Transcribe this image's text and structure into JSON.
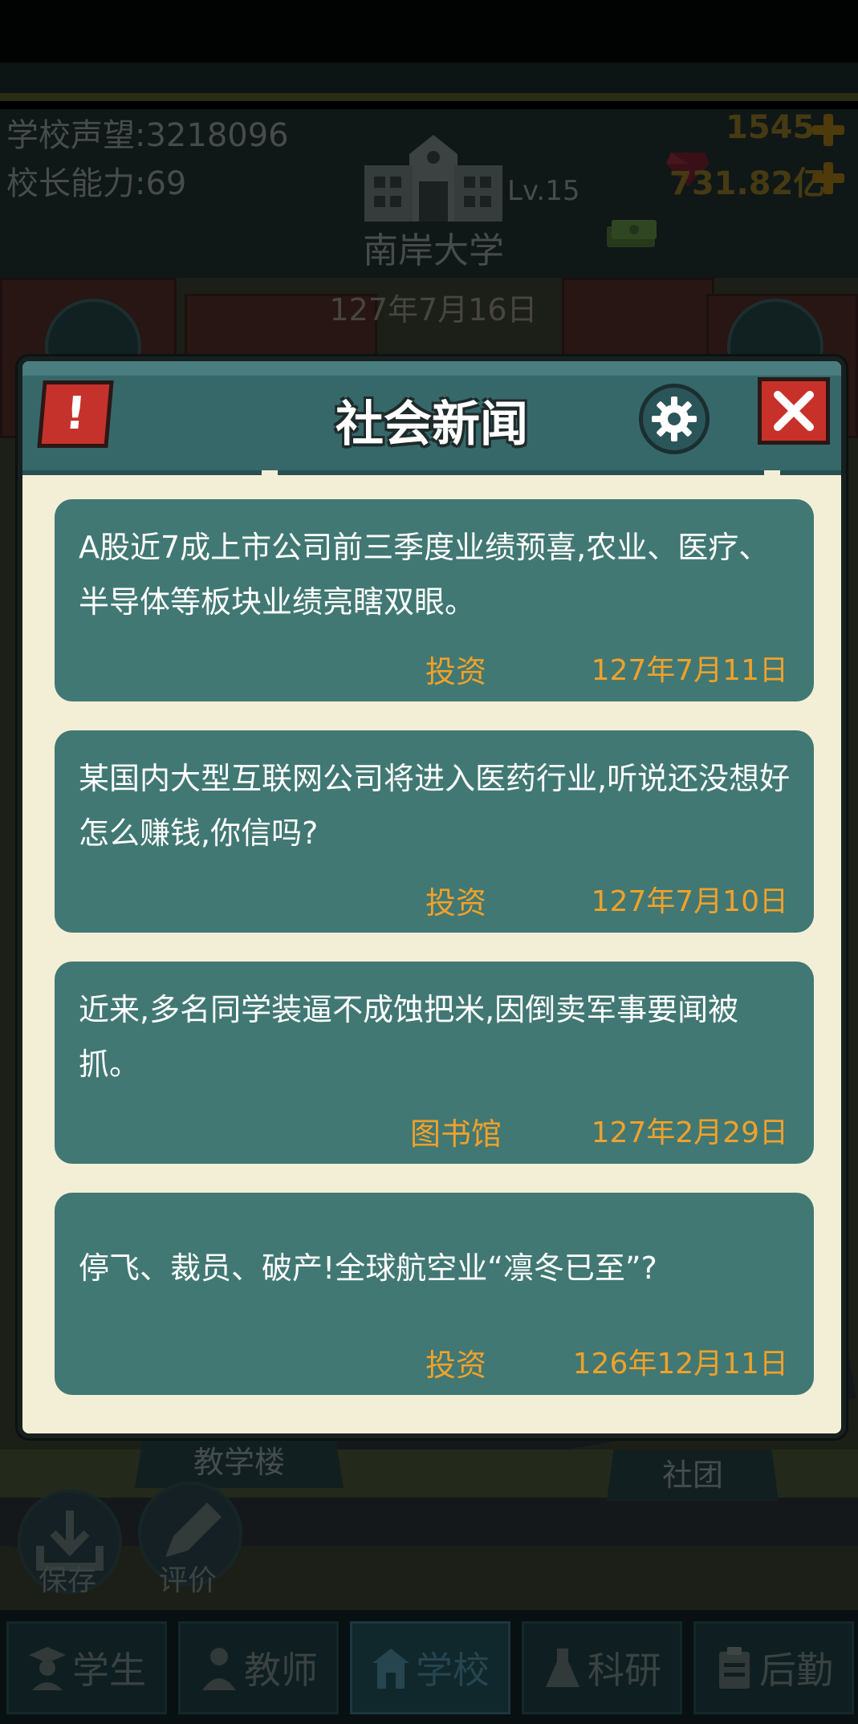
{
  "header": {
    "reputation_label": "学校声望:",
    "reputation_value": "3218096",
    "ability_label": "校长能力:",
    "ability_value": "69",
    "school_level": "Lv.15",
    "school_name": "南岸大学",
    "gems": "1545",
    "money": "731.82亿"
  },
  "game_date": "127年7月16日",
  "map_labels": {
    "teaching_building": "教学楼",
    "club": "社团"
  },
  "side_buttons": {
    "save": "保存",
    "rate": "评价"
  },
  "bottom_nav": [
    {
      "label": "学生",
      "active": false
    },
    {
      "label": "教师",
      "active": false
    },
    {
      "label": "学校",
      "active": true
    },
    {
      "label": "科研",
      "active": false
    },
    {
      "label": "后勤",
      "active": false
    }
  ],
  "dialog": {
    "title": "社会新闻",
    "alert_glyph": "!",
    "news": [
      {
        "text": "A股近7成上市公司前三季度业绩预喜,农业、医疗、半导体等板块业绩亮瞎双眼。",
        "category": "投资",
        "date": "127年7月11日"
      },
      {
        "text": "某国内大型互联网公司将进入医药行业,听说还没想好怎么赚钱,你信吗?",
        "category": "投资",
        "date": "127年7月10日"
      },
      {
        "text": "近来,多名同学装逼不成蚀把米,因倒卖军事要闻被抓。",
        "category": "图书馆",
        "date": "127年2月29日"
      },
      {
        "text": "停飞、裁员、破产!全球航空业“凛冬已至”?",
        "category": "投资",
        "date": "126年12月11日"
      }
    ]
  },
  "colors": {
    "dialog_bg": "#f3efd7",
    "header_teal": "#36686a",
    "card_teal": "#417873",
    "accent_orange": "#f1a12a",
    "close_red": "#c8302a"
  }
}
